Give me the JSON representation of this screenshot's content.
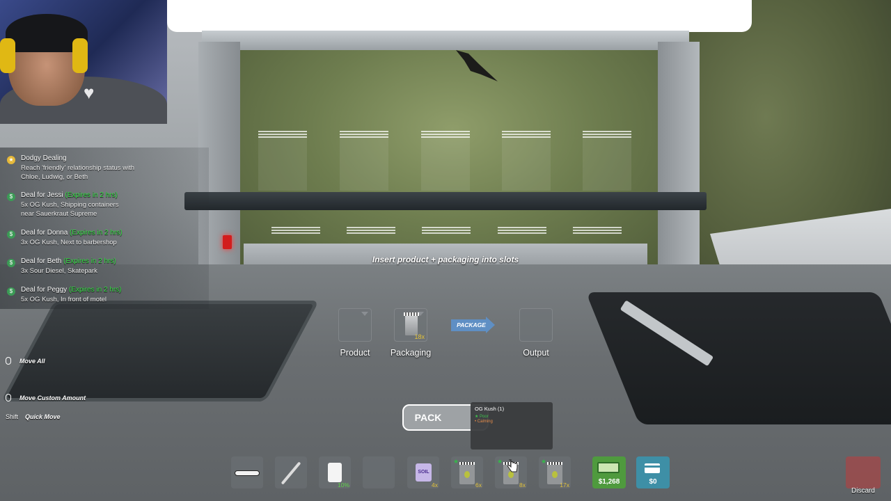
{
  "quests": [
    {
      "icon": "star-icon",
      "title": "Dodgy Dealing",
      "expires": "",
      "desc": "Reach 'friendly' relationship status with Chloe, Ludwig, or Beth"
    },
    {
      "icon": "deal-icon",
      "title": "Deal for Jessi",
      "expires": "(Expires in 2 hrs)",
      "desc": "5x OG Kush, Shipping containers near Sauerkraut Supreme"
    },
    {
      "icon": "deal-icon",
      "title": "Deal for Donna",
      "expires": "(Expires in 2 hrs)",
      "desc": "3x OG Kush, Next to barbershop"
    },
    {
      "icon": "deal-icon",
      "title": "Deal for Beth",
      "expires": "(Expires in 2 hrs)",
      "desc": "3x Sour Diesel, Skatepark"
    },
    {
      "icon": "deal-icon",
      "title": "Deal for Peggy",
      "expires": "(Expires in 2 hrs)",
      "desc": "5x OG Kush, In front of motel"
    }
  ],
  "hints": {
    "move_all": "Move All",
    "move_custom": "Move Custom Amount",
    "shift_key": "Shift",
    "quick_move": "Quick Move"
  },
  "packaging": {
    "instruction": "Insert product + packaging into slots",
    "product_label": "Product",
    "packaging_label": "Packaging",
    "packaging_count": "18x",
    "package_arrow": "PACKAGE",
    "output_label": "Output",
    "pack_button": "PACK"
  },
  "tooltip": {
    "title": "OG Kush (1)",
    "quality": "★ Poor",
    "effect": "• Calming"
  },
  "hotbar": {
    "slot3_count": "10%",
    "slot5_count": "4x",
    "slot5_label": "SOIL",
    "slot6_count": "6x",
    "slot7_count": "8x",
    "slot8_count": "17x",
    "cash": "$1,268",
    "card": "$0",
    "discard": "Discard"
  },
  "colors": {
    "deal_expiry": "#35e044",
    "count_text": "#e3c23a",
    "package_arrow": "#5f8fc4",
    "cash_slot": "#4f9a3e",
    "card_slot": "#3e8fa6"
  }
}
